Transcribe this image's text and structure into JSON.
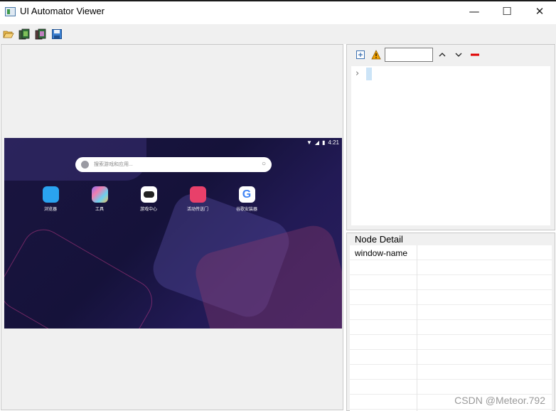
{
  "window": {
    "title": "UI Automator Viewer",
    "minimize_glyph": "—",
    "maximize_glyph": "☐",
    "close_glyph": "✕"
  },
  "toolbar": {
    "icons": [
      "open-folder-icon",
      "device-screenshot-icon",
      "device-screenshot-compressed-icon",
      "save-icon"
    ]
  },
  "device": {
    "status_time": "4:21",
    "search_placeholder": "搜索游戏和应用...",
    "apps": [
      {
        "label": "浏览器",
        "color": "#2aa3f0"
      },
      {
        "label": "工具",
        "color": "#8c6cf0"
      },
      {
        "label": "游戏中心",
        "color": "#ffffff"
      },
      {
        "label": "活动传送门",
        "color": "#e8406a"
      },
      {
        "label": "谷歌安装器",
        "color": "#ffffff"
      }
    ]
  },
  "tree": {
    "filter_value": "",
    "chevron": "›",
    "icons": [
      "expand-all-icon",
      "warning-icon",
      "previous-node-icon",
      "next-node-icon",
      "clear-icon"
    ]
  },
  "node_detail": {
    "title": "Node Detail",
    "rows": [
      {
        "key": "window-name",
        "value": ""
      }
    ]
  },
  "watermark": "CSDN @Meteor.792",
  "colors": {
    "accent_red": "#e00000",
    "warning": "#f0a000",
    "selection": "#cce4f7"
  }
}
